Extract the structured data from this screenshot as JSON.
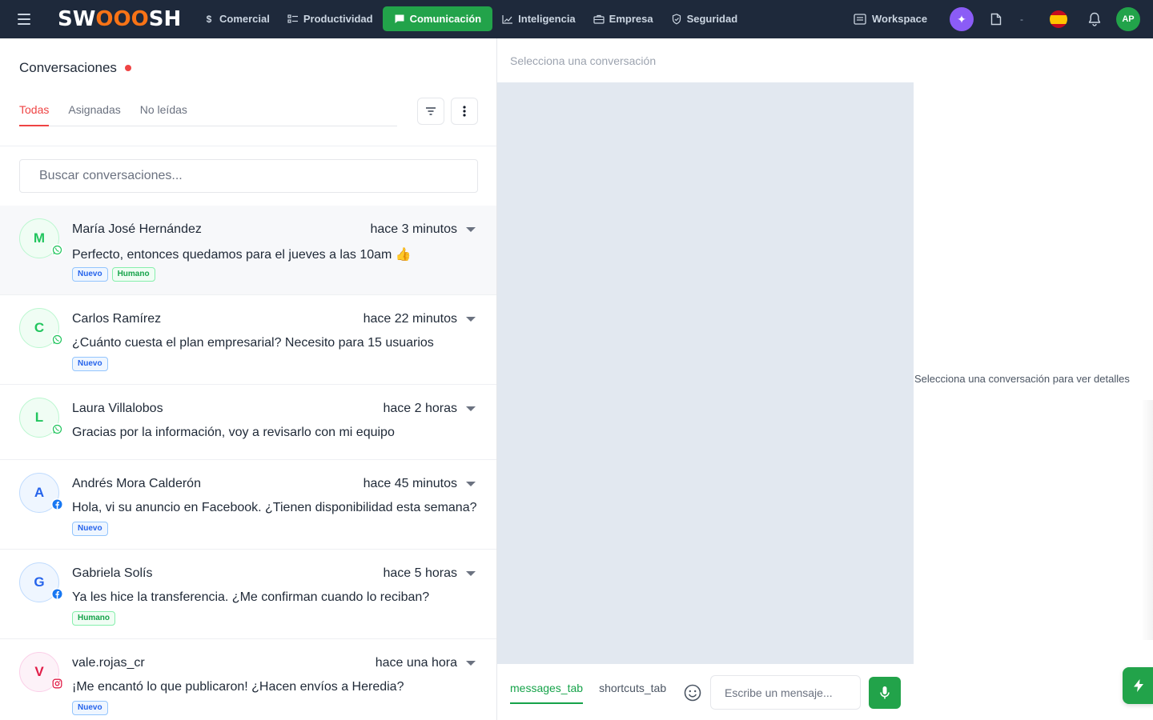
{
  "topnav": {
    "logo": {
      "pre": "SW",
      "mid": "OOO",
      "post": "SH"
    },
    "items": [
      {
        "label": "Comercial",
        "icon": "dollar-icon",
        "active": false
      },
      {
        "label": "Productividad",
        "icon": "checklist-icon",
        "active": false
      },
      {
        "label": "Comunicación",
        "icon": "chat-icon",
        "active": true
      },
      {
        "label": "Inteligencia",
        "icon": "chart-icon",
        "active": false
      },
      {
        "label": "Empresa",
        "icon": "briefcase-icon",
        "active": false
      },
      {
        "label": "Seguridad",
        "icon": "shield-icon",
        "active": false
      }
    ],
    "workspace_label": "Workspace",
    "dash": "-",
    "user_initials": "AP",
    "accent": "#22a34a"
  },
  "conversations": {
    "title": "Conversaciones",
    "tabs": [
      "Todas",
      "Asignadas",
      "No leídas"
    ],
    "active_tab": "Todas",
    "search_placeholder": "Buscar conversaciones...",
    "items": [
      {
        "initial": "M",
        "name": "María José Hernández",
        "time": "hace 3 minutos",
        "message": "Perfecto, entonces quedamos para el jueves a las 10am 👍",
        "channel": "whatsapp",
        "tags": [
          "Nuevo",
          "Humano"
        ],
        "selected": true
      },
      {
        "initial": "C",
        "name": "Carlos Ramírez",
        "time": "hace 22 minutos",
        "message": "¿Cuánto cuesta el plan empresarial? Necesito para 15 usuarios",
        "channel": "whatsapp",
        "tags": [
          "Nuevo"
        ],
        "selected": false
      },
      {
        "initial": "L",
        "name": "Laura Villalobos",
        "time": "hace 2 horas",
        "message": "Gracias por la información, voy a revisarlo con mi equipo",
        "channel": "whatsapp",
        "tags": [],
        "selected": false
      },
      {
        "initial": "A",
        "name": "Andrés Mora Calderón",
        "time": "hace 45 minutos",
        "message": "Hola, vi su anuncio en Facebook. ¿Tienen disponibilidad esta semana?",
        "channel": "facebook",
        "tags": [
          "Nuevo"
        ],
        "selected": false
      },
      {
        "initial": "G",
        "name": "Gabriela Solís",
        "time": "hace 5 horas",
        "message": "Ya les hice la transferencia. ¿Me confirman cuando lo reciban?",
        "channel": "facebook",
        "tags": [
          "Humano"
        ],
        "selected": false
      },
      {
        "initial": "V",
        "name": "vale.rojas_cr",
        "time": "hace una hora",
        "message": "¡Me encantó lo que publicaron! ¿Hacen envíos a Heredia?",
        "channel": "instagram",
        "tags": [
          "Nuevo"
        ],
        "selected": false
      }
    ]
  },
  "chat": {
    "header_placeholder": "Selecciona una conversación",
    "tabs": [
      "messages_tab",
      "shortcuts_tab"
    ],
    "active_tab": "messages_tab",
    "input_placeholder": "Escribe un mensaje..."
  },
  "details": {
    "empty_text": "Selecciona una conversación para ver detalles"
  }
}
